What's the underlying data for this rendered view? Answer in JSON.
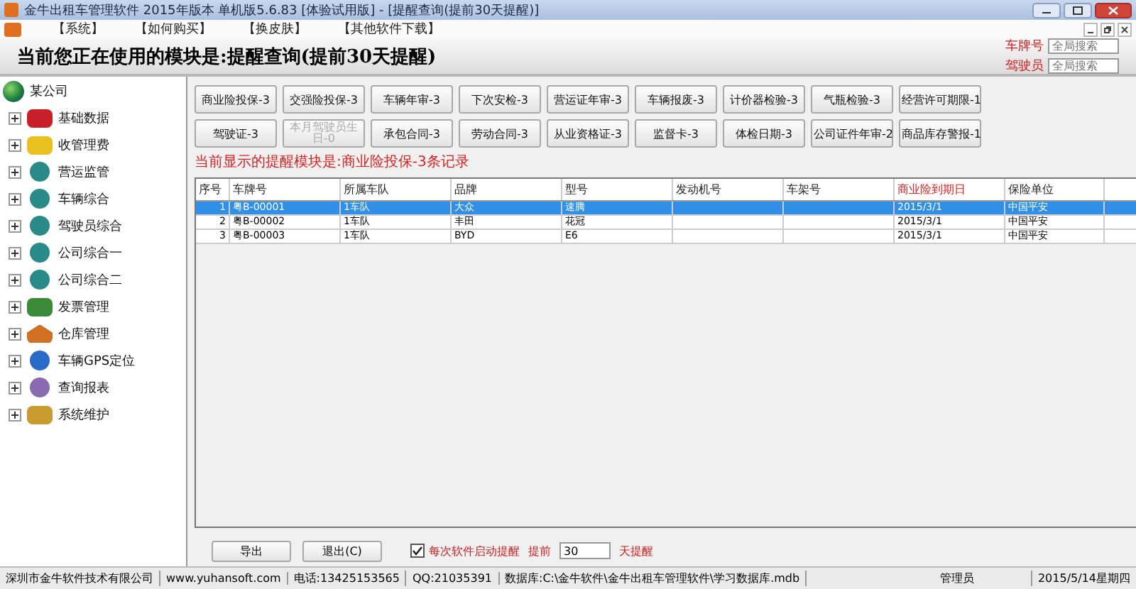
{
  "window": {
    "title": "金牛出租车管理软件 2015年版本 单机版5.6.83 [体验试用版] - [提醒查询(提前30天提醒)]"
  },
  "menu": [
    "【系统】",
    "【如何购买】",
    "【换皮肤】",
    "【其他软件下载】"
  ],
  "header": {
    "title": "当前您正在使用的模块是:提醒查询(提前30天提醒)",
    "search": [
      {
        "label": "车牌号",
        "placeholder": "全局搜索"
      },
      {
        "label": "驾驶员",
        "placeholder": "全局搜索"
      }
    ]
  },
  "tree": {
    "root": "某公司",
    "children": [
      {
        "label": "基础数据",
        "kind": "car",
        "expanded": false
      },
      {
        "label": "收管理费",
        "kind": "money",
        "expanded": false
      },
      {
        "label": "营运监管",
        "kind": "gear",
        "expanded": false
      },
      {
        "label": "车辆综合",
        "kind": "gear",
        "expanded": false
      },
      {
        "label": "驾驶员综合",
        "kind": "gear",
        "expanded": false
      },
      {
        "label": "公司综合一",
        "kind": "gear",
        "expanded": false
      },
      {
        "label": "公司综合二",
        "kind": "gear",
        "expanded": false
      },
      {
        "label": "发票管理",
        "kind": "bill",
        "expanded": false
      },
      {
        "label": "仓库管理",
        "kind": "house",
        "expanded": false
      },
      {
        "label": "车辆GPS定位",
        "kind": "gps",
        "expanded": false
      },
      {
        "label": "查询报表",
        "kind": "search",
        "expanded": false
      },
      {
        "label": "系统维护",
        "kind": "tools",
        "expanded": false
      }
    ]
  },
  "reminder_buttons": [
    {
      "label": "商业险投保-3",
      "disabled": false
    },
    {
      "label": "交强险投保-3",
      "disabled": false
    },
    {
      "label": "车辆年审-3",
      "disabled": false
    },
    {
      "label": "下次安检-3",
      "disabled": false
    },
    {
      "label": "营运证年审-3",
      "disabled": false
    },
    {
      "label": "车辆报废-3",
      "disabled": false
    },
    {
      "label": "计价器检验-3",
      "disabled": false
    },
    {
      "label": "气瓶检验-3",
      "disabled": false
    },
    {
      "label": "经营许可期限-1",
      "disabled": false
    },
    {
      "label": "驾驶证-3",
      "disabled": false
    },
    {
      "label": "本月驾驶员生日-0",
      "disabled": true
    },
    {
      "label": "承包合同-3",
      "disabled": false
    },
    {
      "label": "劳动合同-3",
      "disabled": false
    },
    {
      "label": "从业资格证-3",
      "disabled": false
    },
    {
      "label": "监督卡-3",
      "disabled": false
    },
    {
      "label": "体检日期-3",
      "disabled": false
    },
    {
      "label": "公司证件年审-2",
      "disabled": false
    },
    {
      "label": "商品库存警报-1",
      "disabled": false
    }
  ],
  "status_message": "当前显示的提醒模块是:商业险投保-3条记录",
  "table": {
    "columns": [
      {
        "label": "序号",
        "highlight": false
      },
      {
        "label": "车牌号",
        "highlight": false
      },
      {
        "label": "所属车队",
        "highlight": false
      },
      {
        "label": "品牌",
        "highlight": false
      },
      {
        "label": "型号",
        "highlight": false
      },
      {
        "label": "发动机号",
        "highlight": false
      },
      {
        "label": "车架号",
        "highlight": false
      },
      {
        "label": "商业险到期日",
        "highlight": true
      },
      {
        "label": "保险单位",
        "highlight": false
      }
    ],
    "rows": [
      {
        "selected": true,
        "cells": [
          "1",
          "粤B-00001",
          "1车队",
          "大众",
          "速腾",
          "",
          "",
          "2015/3/1",
          "中国平安"
        ]
      },
      {
        "selected": false,
        "cells": [
          "2",
          "粤B-00002",
          "1车队",
          "丰田",
          "花冠",
          "",
          "",
          "2015/3/1",
          "中国平安"
        ]
      },
      {
        "selected": false,
        "cells": [
          "3",
          "粤B-00003",
          "1车队",
          "BYD",
          "E6",
          "",
          "",
          "2015/3/1",
          "中国平安"
        ]
      }
    ]
  },
  "footer": {
    "buttons": [
      "导出",
      "退出(C)"
    ],
    "auto_remind": {
      "label": "每次软件启动提醒",
      "checked": true
    },
    "advance_label": "提前",
    "advance_days": "30",
    "days_label": "天提醒"
  },
  "status_bar": [
    "深圳市金牛软件技术有限公司",
    "www.yuhansoft.com",
    "电话:13425153565",
    "QQ:21035391",
    "数据库:C:\\金牛软件\\金牛出租车管理软件\\学习数据库.mdb",
    "管理员",
    "2015/5/14星期四"
  ]
}
